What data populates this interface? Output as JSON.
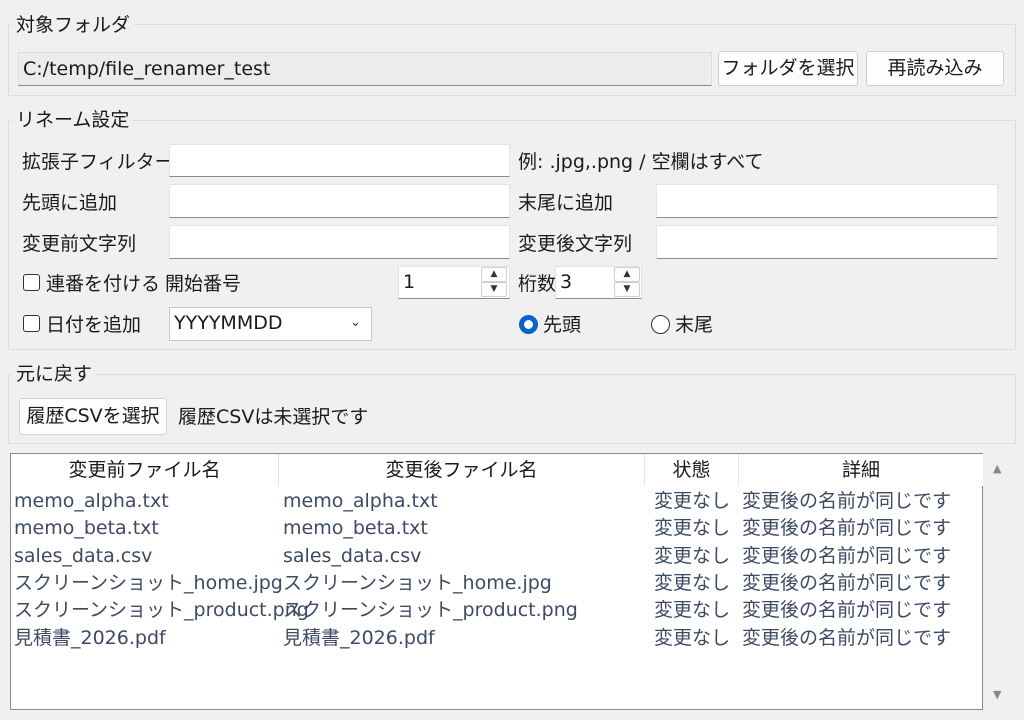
{
  "folder_group": {
    "title": "対象フォルダ",
    "path": "C:/temp/file_renamer_test",
    "select_label": "フォルダを選択",
    "reload_label": "再読み込み"
  },
  "rename_group": {
    "title": "リネーム設定",
    "ext_filter_label": "拡張子フィルター",
    "ext_filter_value": "",
    "ext_hint": "例: .jpg,.png / 空欄はすべて",
    "prefix_label": "先頭に追加",
    "prefix_value": "",
    "suffix_label": "末尾に追加",
    "suffix_value": "",
    "before_label": "変更前文字列",
    "before_value": "",
    "after_label": "変更後文字列",
    "after_value": "",
    "seq_checkbox_label": "連番を付ける",
    "seq_checked": false,
    "start_num_label": "開始番号",
    "start_num_value": "1",
    "digits_label": "桁数",
    "digits_value": "3",
    "date_checkbox_label": "日付を追加",
    "date_checked": false,
    "date_format": "YYYYMMDD",
    "position_options": [
      {
        "label": "先頭",
        "selected": true
      },
      {
        "label": "末尾",
        "selected": false
      }
    ]
  },
  "undo_group": {
    "title": "元に戻す",
    "history_button": "履歴CSVを選択",
    "history_status": "履歴CSVは未選択です"
  },
  "table": {
    "headers": [
      "変更前ファイル名",
      "変更後ファイル名",
      "状態",
      "詳細"
    ],
    "rows": [
      [
        "memo_alpha.txt",
        "memo_alpha.txt",
        "変更なし",
        "変更後の名前が同じです"
      ],
      [
        "memo_beta.txt",
        "memo_beta.txt",
        "変更なし",
        "変更後の名前が同じです"
      ],
      [
        "sales_data.csv",
        "sales_data.csv",
        "変更なし",
        "変更後の名前が同じです"
      ],
      [
        "スクリーンショット_home.jpg",
        "スクリーンショット_home.jpg",
        "変更なし",
        "変更後の名前が同じです"
      ],
      [
        "スクリーンショット_product.png",
        "スクリーンショット_product.png",
        "変更なし",
        "変更後の名前が同じです"
      ],
      [
        "見積書_2026.pdf",
        "見積書_2026.pdf",
        "変更なし",
        "変更後の名前が同じです"
      ]
    ]
  },
  "colors": {
    "accent": "#0a63c6",
    "background": "#f0f0f0",
    "table_text": "#3c4a63"
  }
}
